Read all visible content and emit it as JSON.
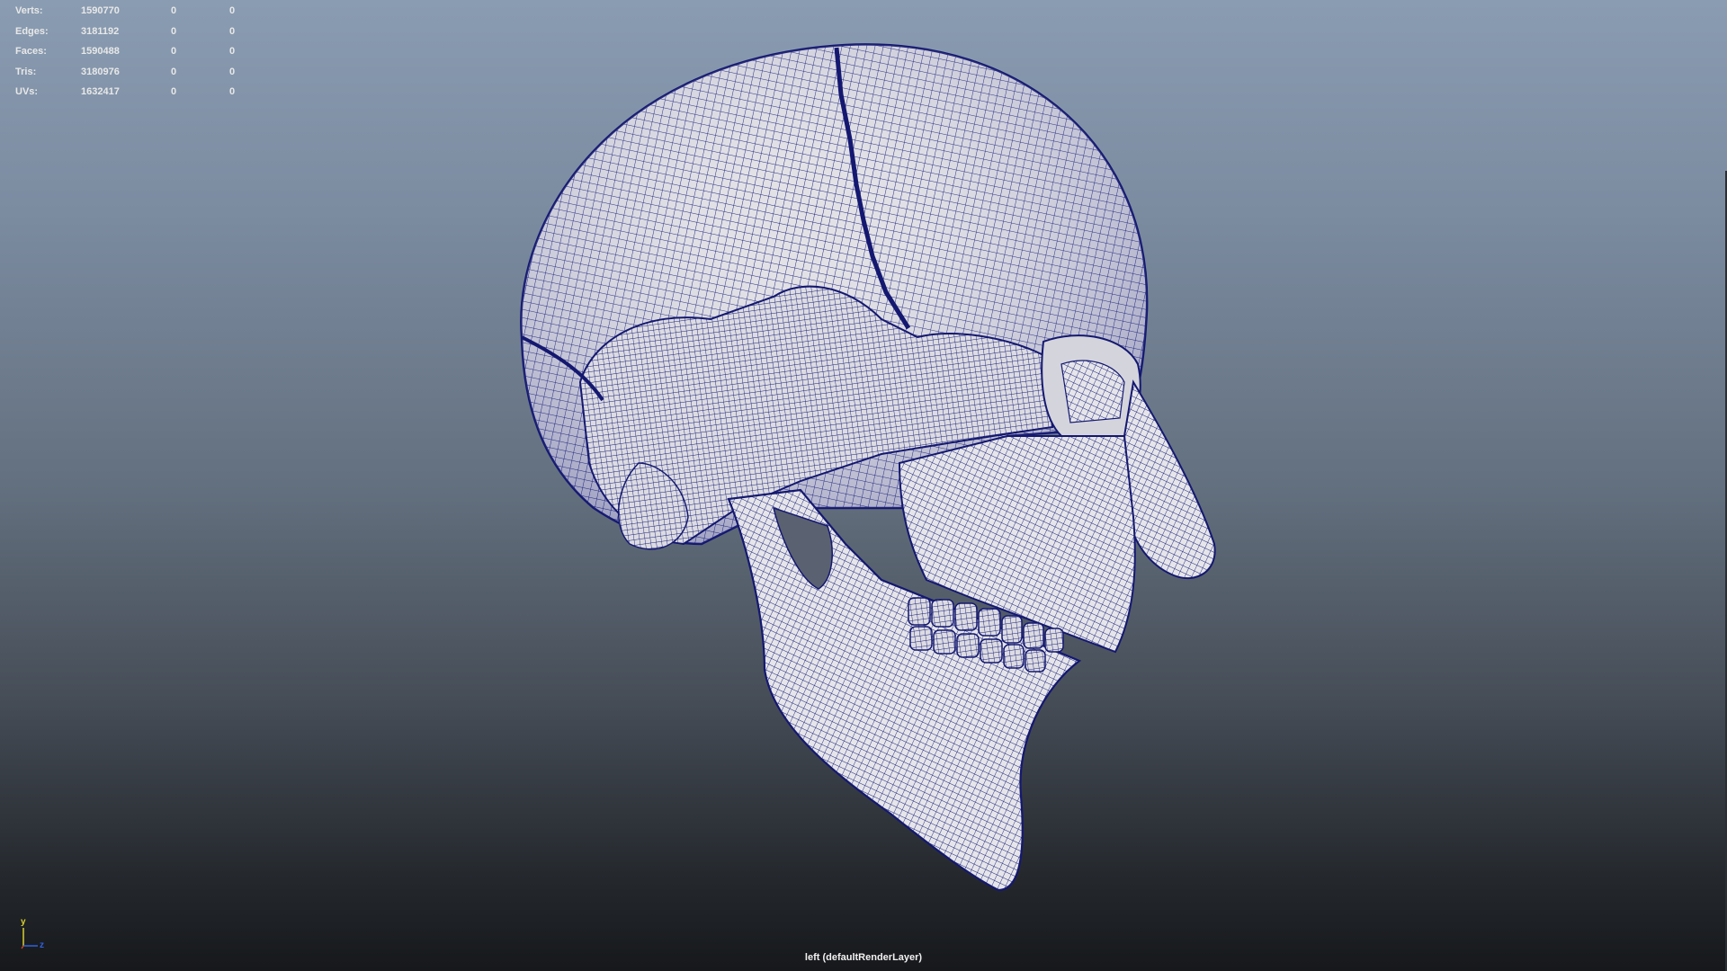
{
  "hud": {
    "rows": [
      {
        "label": "Verts:",
        "value": "1590770",
        "selected": "0",
        "component": "0"
      },
      {
        "label": "Edges:",
        "value": "3181192",
        "selected": "0",
        "component": "0"
      },
      {
        "label": "Faces:",
        "value": "1590488",
        "selected": "0",
        "component": "0"
      },
      {
        "label": "Tris:",
        "value": "3180976",
        "selected": "0",
        "component": "0"
      },
      {
        "label": "UVs:",
        "value": "1632417",
        "selected": "0",
        "component": "0"
      }
    ]
  },
  "viewport": {
    "camera_label": "left (defaultRenderLayer)",
    "background_top": "#8a9cb2",
    "background_bottom": "#16181b",
    "wire_color": "#1a1f7a",
    "surface_color": "#e4e4e8"
  },
  "axis": {
    "y_label": "y",
    "z_label": "z",
    "y_color": "#d8d030",
    "x_color": "#c84020",
    "z_color": "#3060e0"
  }
}
